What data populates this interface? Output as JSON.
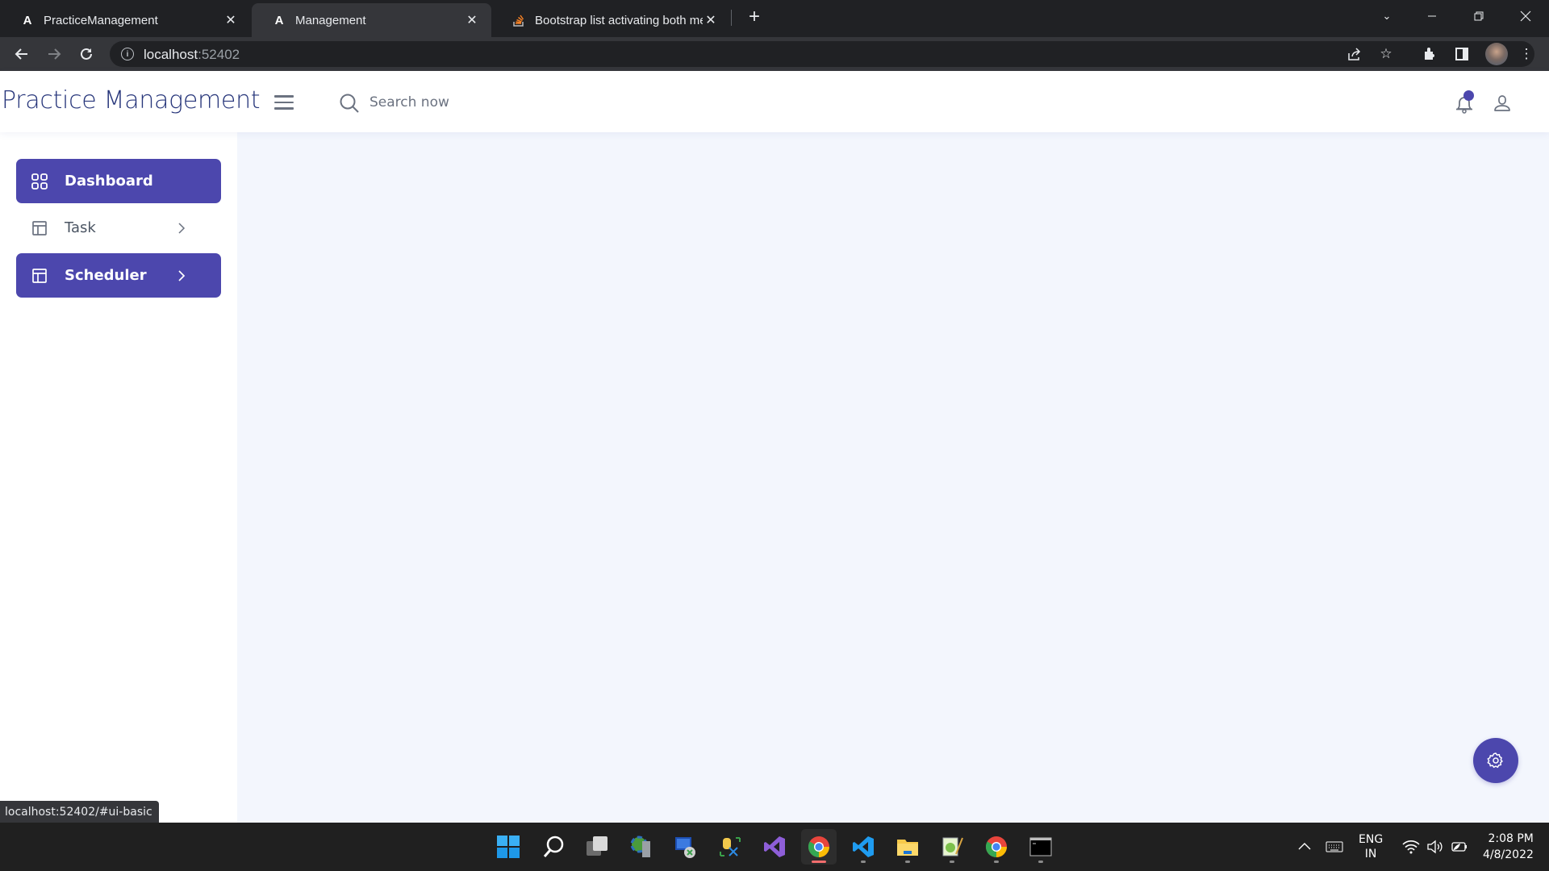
{
  "browser": {
    "tabs": [
      {
        "title": "PracticeManagement",
        "favicon": "angular-icon",
        "active": false
      },
      {
        "title": "Management",
        "favicon": "angular-icon",
        "active": true
      },
      {
        "title": "Bootstrap list activating both menu",
        "favicon": "stackoverflow-icon",
        "active": false
      }
    ],
    "new_tab_label": "+",
    "url_host": "localhost",
    "url_port": ":52402",
    "status_url": "localhost:52402/#ui-basic"
  },
  "app": {
    "brand": "Practice Management",
    "search": {
      "placeholder": "Search now",
      "value": ""
    },
    "notification_badge": true,
    "accent_color": "#4c47ad"
  },
  "sidebar": {
    "items": [
      {
        "label": "Dashboard",
        "icon": "grid-icon",
        "active": true,
        "has_children": false
      },
      {
        "label": "Task",
        "icon": "layout-icon",
        "active": false,
        "has_children": true
      },
      {
        "label": "Scheduler",
        "icon": "layout-icon",
        "active": true,
        "has_children": true
      }
    ]
  },
  "taskbar": {
    "apps": [
      {
        "name": "start",
        "active": false,
        "running": false
      },
      {
        "name": "search",
        "active": false,
        "running": false
      },
      {
        "name": "task-view",
        "active": false,
        "running": false
      },
      {
        "name": "iis-manager",
        "active": false,
        "running": false
      },
      {
        "name": "remote-desktop",
        "active": false,
        "running": false
      },
      {
        "name": "sql-tools",
        "active": false,
        "running": false
      },
      {
        "name": "visual-studio",
        "active": false,
        "running": false
      },
      {
        "name": "chrome",
        "active": true,
        "running": true
      },
      {
        "name": "vscode",
        "active": false,
        "running": true
      },
      {
        "name": "file-explorer",
        "active": false,
        "running": true
      },
      {
        "name": "notepad-plus-plus",
        "active": false,
        "running": true
      },
      {
        "name": "chrome-2",
        "active": false,
        "running": true
      },
      {
        "name": "terminal",
        "active": false,
        "running": true
      }
    ],
    "language_line1": "ENG",
    "language_line2": "IN",
    "time": "2:08 PM",
    "date": "4/8/2022"
  }
}
